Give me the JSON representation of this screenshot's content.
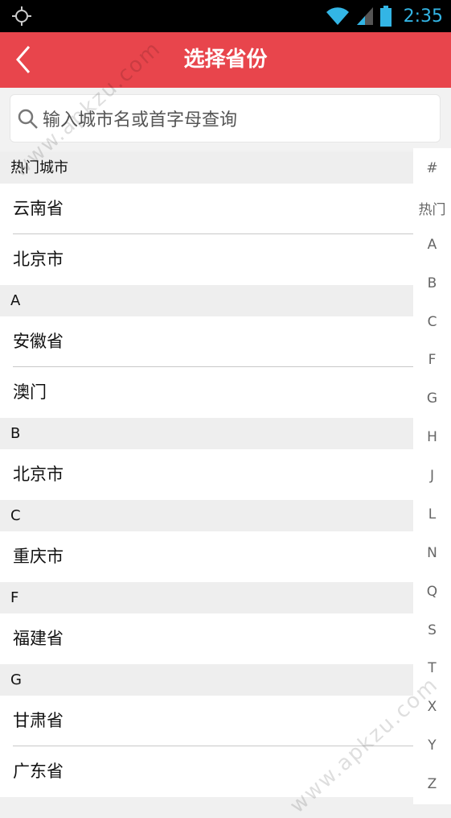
{
  "status_bar": {
    "time": "2:35"
  },
  "header": {
    "title": "选择省份"
  },
  "search": {
    "placeholder": "输入城市名或首字母查询"
  },
  "sections": [
    {
      "title": "热门城市",
      "items": [
        "云南省",
        "北京市"
      ]
    },
    {
      "title": "A",
      "items": [
        "安徽省",
        "澳门"
      ]
    },
    {
      "title": "B",
      "items": [
        "北京市"
      ]
    },
    {
      "title": "C",
      "items": [
        "重庆市"
      ]
    },
    {
      "title": "F",
      "items": [
        "福建省"
      ]
    },
    {
      "title": "G",
      "items": [
        "甘肃省",
        "广东省"
      ]
    }
  ],
  "index": [
    "#",
    "热门",
    "A",
    "B",
    "C",
    "F",
    "G",
    "H",
    "J",
    "L",
    "N",
    "Q",
    "S",
    "T",
    "X",
    "Y",
    "Z"
  ],
  "watermark": {
    "text": "www.apkzu.com"
  },
  "colors": {
    "accent": "#e8454c",
    "clock": "#33b5e5"
  }
}
